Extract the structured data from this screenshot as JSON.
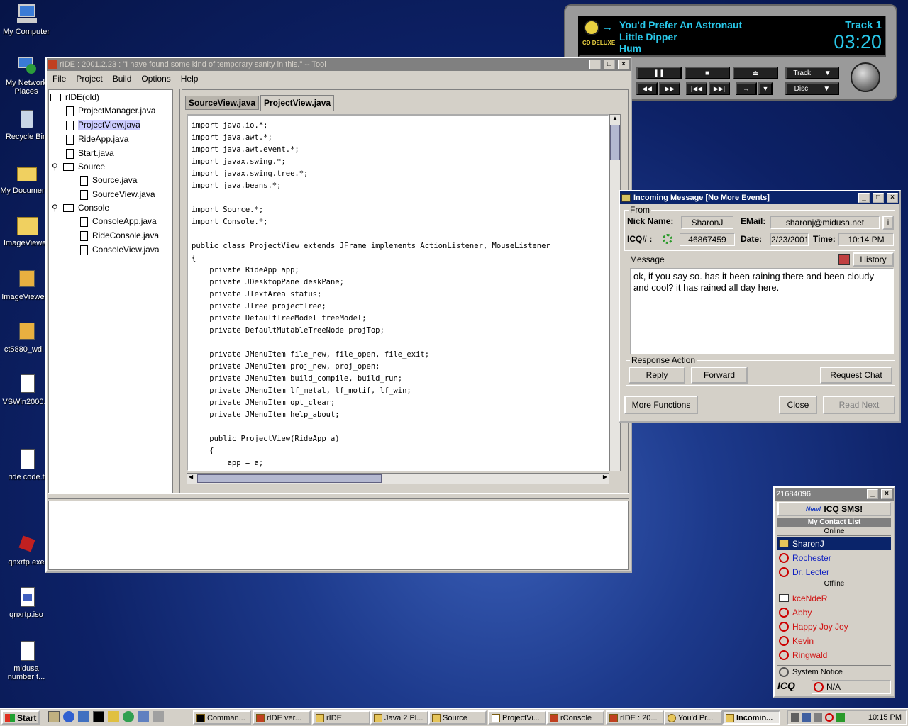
{
  "desktop": {
    "icons": [
      "My Computer",
      "My Network Places",
      "Recycle Bin",
      "My Documents",
      "ImageViewer",
      "ImageViewe...",
      "ct5880_wd...",
      "VSWin2000...",
      "ride code.t",
      "qnxrtp.exe",
      "qnxrtp.iso",
      "midusa number t..."
    ]
  },
  "cd_player": {
    "song": "You'd Prefer An Astronaut",
    "album": "Little Dipper",
    "artist": "Hum",
    "track_label": "Track 1",
    "time": "03:20",
    "logo": "CD DELUXE",
    "track_btn": "Track",
    "disc_btn": "Disc"
  },
  "ide": {
    "title": "rIDE : 2001.2.23 : \"I have found some kind of temporary sanity in this.\" -- Tool",
    "menu": [
      "File",
      "Project",
      "Build",
      "Options",
      "Help"
    ],
    "tree": {
      "root": "rIDE(old)",
      "files": [
        "ProjectManager.java",
        "ProjectView.java",
        "RideApp.java",
        "Start.java"
      ],
      "source_folder": "Source",
      "source_files": [
        "Source.java",
        "SourceView.java"
      ],
      "console_folder": "Console",
      "console_files": [
        "ConsoleApp.java",
        "RideConsole.java",
        "ConsoleView.java"
      ]
    },
    "tabs": [
      "SourceView.java",
      "ProjectView.java"
    ],
    "code": "import java.io.*;\nimport java.awt.*;\nimport java.awt.event.*;\nimport javax.swing.*;\nimport javax.swing.tree.*;\nimport java.beans.*;\n\nimport Source.*;\nimport Console.*;\n\npublic class ProjectView extends JFrame implements ActionListener, MouseListener\n{\n    private RideApp app;\n    private JDesktopPane deskPane;\n    private JTextArea status;\n    private JTree projectTree;\n    private DefaultTreeModel treeModel;\n    private DefaultMutableTreeNode projTop;\n\n    private JMenuItem file_new, file_open, file_exit;\n    private JMenuItem proj_new, proj_open;\n    private JMenuItem build_compile, build_run;\n    private JMenuItem lf_metal, lf_motif, lf_win;\n    private JMenuItem opt_clear;\n    private JMenuItem help_about;\n\n    public ProjectView(RideApp a)\n    {\n        app = a;\n        setJMenuBar(createMenus());"
  },
  "icq_msg": {
    "title": "Incoming Message [No More Events]",
    "from_label": "From",
    "nick_label": "Nick Name:",
    "nick": "SharonJ",
    "email_label": "EMail:",
    "email": "sharonj@midusa.net",
    "icq_label": "ICQ# :",
    "icq": "46867459",
    "date_label": "Date:",
    "date": "2/23/2001",
    "time_label": "Time:",
    "time": "10:14 PM",
    "message_label": "Message",
    "history_btn": "History",
    "message": "ok, if you say so. has it been raining there and been cloudy and cool? it has rained all day here.",
    "response_label": "Response Action",
    "reply_btn": "Reply",
    "forward_btn": "Forward",
    "request_chat_btn": "Request Chat",
    "more_btn": "More Functions",
    "close_btn": "Close",
    "read_next_btn": "Read Next"
  },
  "icq_list": {
    "uin": "21684096",
    "sms_new": "New!",
    "sms": "ICQ SMS!",
    "header": "My Contact List",
    "online_label": "Online",
    "online": [
      "SharonJ",
      "Rochester",
      "Dr. Lecter"
    ],
    "offline_label": "Offline",
    "offline": [
      "kceNdeR",
      "Abby",
      "Happy Joy Joy",
      "Kevin",
      "Ringwald"
    ],
    "system_notice": "System Notice",
    "logo": "ICQ",
    "status": "N/A"
  },
  "taskbar": {
    "start": "Start",
    "buttons": [
      "Comman...",
      "rIDE ver...",
      "rIDE",
      "Java 2 Pl...",
      "Source",
      "ProjectVi...",
      "rConsole",
      "rIDE : 20...",
      "You'd Pr...",
      "Incomin..."
    ],
    "clock": "10:15 PM"
  },
  "colors": {
    "title_active": "#0a246a",
    "title_inactive": "#808080",
    "cd_text": "#29c7e8"
  }
}
